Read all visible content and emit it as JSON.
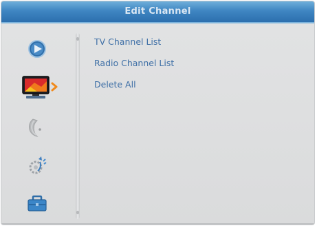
{
  "header": {
    "title": "Edit Channel"
  },
  "sidebar": {
    "icons": [
      {
        "name": "media-play-icon",
        "selected": false
      },
      {
        "name": "tv-channel-icon",
        "selected": true
      },
      {
        "name": "satellite-dish-icon",
        "selected": false
      },
      {
        "name": "settings-gear-icon",
        "selected": false
      },
      {
        "name": "toolbox-icon",
        "selected": false
      }
    ],
    "selection_arrow_color": "#f08a1c"
  },
  "menu": {
    "items": [
      {
        "label": "TV Channel List"
      },
      {
        "label": "Radio Channel List"
      },
      {
        "label": "Delete All"
      }
    ]
  },
  "colors": {
    "title_bar": "#3f86c2",
    "menu_text": "#3e6fa6",
    "background": "#dcdddf"
  }
}
